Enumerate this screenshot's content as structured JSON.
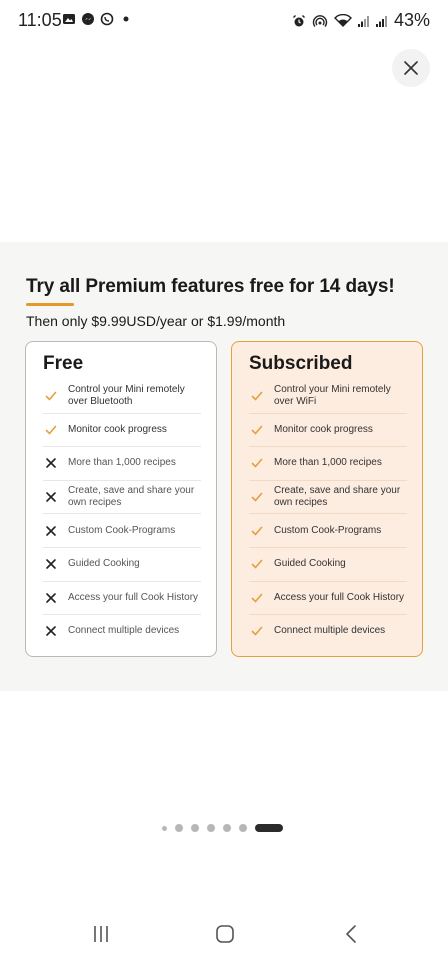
{
  "status_bar": {
    "time": "11:05",
    "battery": "43%",
    "icons_left": [
      "gallery-icon",
      "messenger-icon",
      "whatsapp-icon",
      "dot-icon"
    ],
    "icons_right": [
      "alarm-icon",
      "hotspot-icon",
      "wifi-icon",
      "signal-icon",
      "signal-icon"
    ]
  },
  "header": {
    "title": "Try all Premium features free for 14 days!",
    "subtitle": "Then only $9.99USD/year or $1.99/month"
  },
  "plans": {
    "free": {
      "title": "Free",
      "features": [
        {
          "text": "Control your Mini remotely over Bluetooth",
          "included": true
        },
        {
          "text": "Monitor cook progress",
          "included": true
        },
        {
          "text": "More than 1,000 recipes",
          "included": false
        },
        {
          "text": "Create, save and share your own recipes",
          "included": false
        },
        {
          "text": "Custom Cook-Programs",
          "included": false
        },
        {
          "text": "Guided Cooking",
          "included": false
        },
        {
          "text": "Access your full Cook History",
          "included": false
        },
        {
          "text": "Connect multiple devices",
          "included": false
        }
      ]
    },
    "subscribed": {
      "title": "Subscribed",
      "features": [
        {
          "text": "Control your Mini remotely over WiFi",
          "included": true
        },
        {
          "text": "Monitor cook progress",
          "included": true
        },
        {
          "text": "More than 1,000 recipes",
          "included": true
        },
        {
          "text": "Create, save and share your own recipes",
          "included": true
        },
        {
          "text": "Custom Cook-Programs",
          "included": true
        },
        {
          "text": "Guided Cooking",
          "included": true
        },
        {
          "text": "Access your full Cook History",
          "included": true
        },
        {
          "text": "Connect multiple devices",
          "included": true
        }
      ]
    }
  },
  "pager": {
    "count": 7,
    "active_index": 6
  },
  "colors": {
    "accent": "#e39a2a",
    "sub_bg": "#fdece0",
    "check": "#e3a03b",
    "cross": "#222222"
  }
}
